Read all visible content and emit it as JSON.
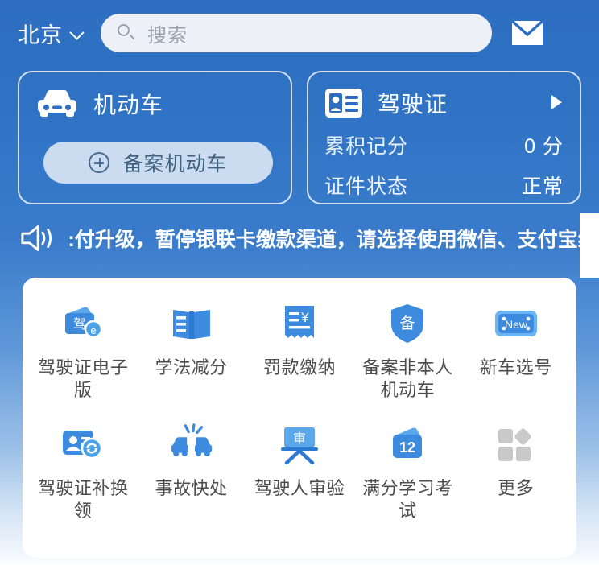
{
  "header": {
    "city": "北京",
    "city_chevron_icon": "chevron-down-icon",
    "search": {
      "icon": "search-icon",
      "placeholder": "搜索",
      "value": ""
    },
    "mail_icon": "mail-icon"
  },
  "cards": {
    "vehicle": {
      "icon": "car-icon",
      "title": "机动车",
      "button": {
        "icon": "plus-circle-icon",
        "label": "备案机动车"
      }
    },
    "license": {
      "icon": "id-card-icon",
      "title": "驾驶证",
      "arrow_icon": "arrow-right-icon",
      "rows": [
        {
          "label": "累积记分",
          "value": "0 分"
        },
        {
          "label": "证件状态",
          "value": "正常"
        }
      ]
    }
  },
  "notice": {
    "icon": "megaphone-icon",
    "text": ":付升级，暂停银联卡缴款渠道，请选择使用微信、支付宝缴款"
  },
  "grid": {
    "items": [
      {
        "label": "驾驶证电子版",
        "icon": "driver-license-ecard-icon",
        "badge": "驾"
      },
      {
        "label": "学法减分",
        "icon": "open-book-icon"
      },
      {
        "label": "罚款缴纳",
        "icon": "receipt-yuan-icon"
      },
      {
        "label": "备案非本人机动车",
        "icon": "shield-record-icon",
        "badge": "备"
      },
      {
        "label": "新车选号",
        "icon": "license-plate-new-icon",
        "badge": "New"
      },
      {
        "label": "驾驶证补换领",
        "icon": "card-renew-icon"
      },
      {
        "label": "事故快处",
        "icon": "accident-cars-icon"
      },
      {
        "label": "驾驶人审验",
        "icon": "review-board-icon",
        "badge": "审"
      },
      {
        "label": "满分学习考试",
        "icon": "twelve-points-icon",
        "badge": "12"
      },
      {
        "label": "更多",
        "icon": "more-grid-icon"
      }
    ]
  },
  "colors": {
    "brand_blue": "#2d6ec0",
    "icon_blue": "#3d8bdf",
    "icon_blue_dark": "#2b7ad4",
    "pill_bg": "#cbdcf0",
    "pill_text": "#3f617f",
    "label_gray": "#4c4c4c",
    "more_gray": "#c9c9c9"
  }
}
